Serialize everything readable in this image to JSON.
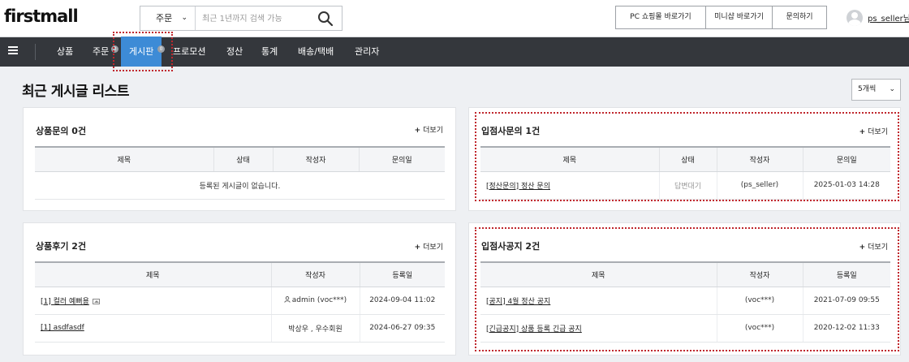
{
  "header": {
    "logo": "firstmall",
    "search": {
      "category": "주문",
      "placeholder": "최근 1년까지 검색 가능"
    },
    "links": [
      "PC 쇼핑몰 바로가기",
      "미니샵 바로가기",
      "문의하기"
    ],
    "username": "ps_seller님"
  },
  "nav": {
    "items": [
      {
        "label": "상품"
      },
      {
        "label": "주문",
        "badge": "0"
      },
      {
        "label": "게시판",
        "badge": "0",
        "active": true
      },
      {
        "label": "프로모션"
      },
      {
        "label": "정산"
      },
      {
        "label": "통계"
      },
      {
        "label": "배송/택배"
      },
      {
        "label": "관리자"
      }
    ]
  },
  "page": {
    "title": "최근 게시글 리스트",
    "per_page": "5개씩"
  },
  "more_label": "더보기",
  "panels": {
    "product_qna": {
      "title": "상품문의 0건",
      "columns": [
        "제목",
        "상태",
        "작성자",
        "문의일"
      ],
      "empty_message": "등록된 게시글이 없습니다."
    },
    "seller_qna": {
      "title": "입점사문의 1건",
      "columns": [
        "제목",
        "상태",
        "작성자",
        "문의일"
      ],
      "rows": [
        {
          "title": "[정산문의] 정산 문의",
          "status": "답변대기",
          "author": "(ps_seller)",
          "date": "2025-01-03 14:28"
        }
      ]
    },
    "product_review": {
      "title": "상품후기 2건",
      "columns": [
        "제목",
        "작성자",
        "등록일"
      ],
      "rows": [
        {
          "title": "[1] 컬러 예뻐용",
          "author_name": "admin",
          "author_id": "(voc***)",
          "date": "2024-09-04 11:02"
        },
        {
          "title": "[1] asdfasdf",
          "author": "박상우 , 우수회원",
          "date": "2024-06-27 09:35"
        }
      ]
    },
    "seller_notice": {
      "title": "입점사공지 2건",
      "columns": [
        "제목",
        "작성자",
        "등록일"
      ],
      "rows": [
        {
          "title": "[공지] 4월 정산 공지",
          "author": "(voc***)",
          "date": "2021-07-09 09:55"
        },
        {
          "title": "[긴급공지] 상품 등록 긴급 공지",
          "author": "(voc***)",
          "date": "2020-12-02 11:33"
        }
      ]
    }
  },
  "colors": {
    "accent": "#3d8bd6",
    "nav_bg": "#34373c",
    "highlight": "#c0272d"
  }
}
